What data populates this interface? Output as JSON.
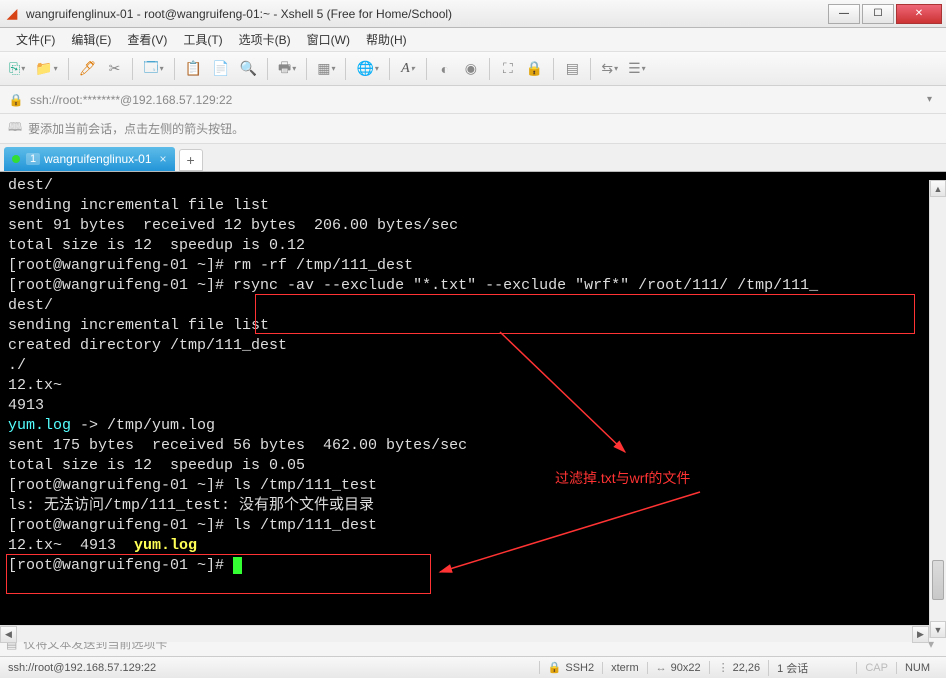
{
  "window": {
    "title": "wangruifenglinux-01 - root@wangruifeng-01:~ - Xshell 5 (Free for Home/School)"
  },
  "menu": {
    "file": "文件(F)",
    "edit": "编辑(E)",
    "view": "查看(V)",
    "tools": "工具(T)",
    "tabs": "选项卡(B)",
    "window": "窗口(W)",
    "help": "帮助(H)"
  },
  "address": {
    "text": "ssh://root:********@192.168.57.129:22"
  },
  "hint": {
    "text": "要添加当前会话，点击左侧的箭头按钮。"
  },
  "tab": {
    "num": "1",
    "label": "wangruifenglinux-01"
  },
  "terminal": {
    "lines": [
      "dest/",
      "sending incremental file list",
      "",
      "sent 91 bytes  received 12 bytes  206.00 bytes/sec",
      "total size is 12  speedup is 0.12",
      "[root@wangruifeng-01 ~]# rm -rf /tmp/111_dest",
      "[root@wangruifeng-01 ~]# rsync -av --exclude \"*.txt\" --exclude \"wrf*\" /root/111/ /tmp/111_",
      "dest/",
      "sending incremental file list",
      "created directory /tmp/111_dest",
      "./",
      "12.tx~",
      "4913",
      "yum.log -> /tmp/yum.log",
      "",
      "sent 175 bytes  received 56 bytes  462.00 bytes/sec",
      "total size is 12  speedup is 0.05",
      "[root@wangruifeng-01 ~]# ls /tmp/111_test",
      "ls: 无法访问/tmp/111_test: 没有那个文件或目录",
      "[root@wangruifeng-01 ~]# ls /tmp/111_dest",
      "12.tx~  4913  ",
      "[root@wangruifeng-01 ~]# "
    ],
    "yumlog": "yum.log",
    "cyanlink": "yum.log"
  },
  "annotation": {
    "text": "过滤掉.txt与wrf的文件"
  },
  "sendbar": {
    "text": "仅将文本发送到当前选项卡"
  },
  "status": {
    "conn": "ssh://root@192.168.57.129:22",
    "proto": "SSH2",
    "term": "xterm",
    "size": "90x22",
    "pos": "22,26",
    "sessions": "1 会话",
    "caps": "CAP",
    "num": "NUM"
  }
}
